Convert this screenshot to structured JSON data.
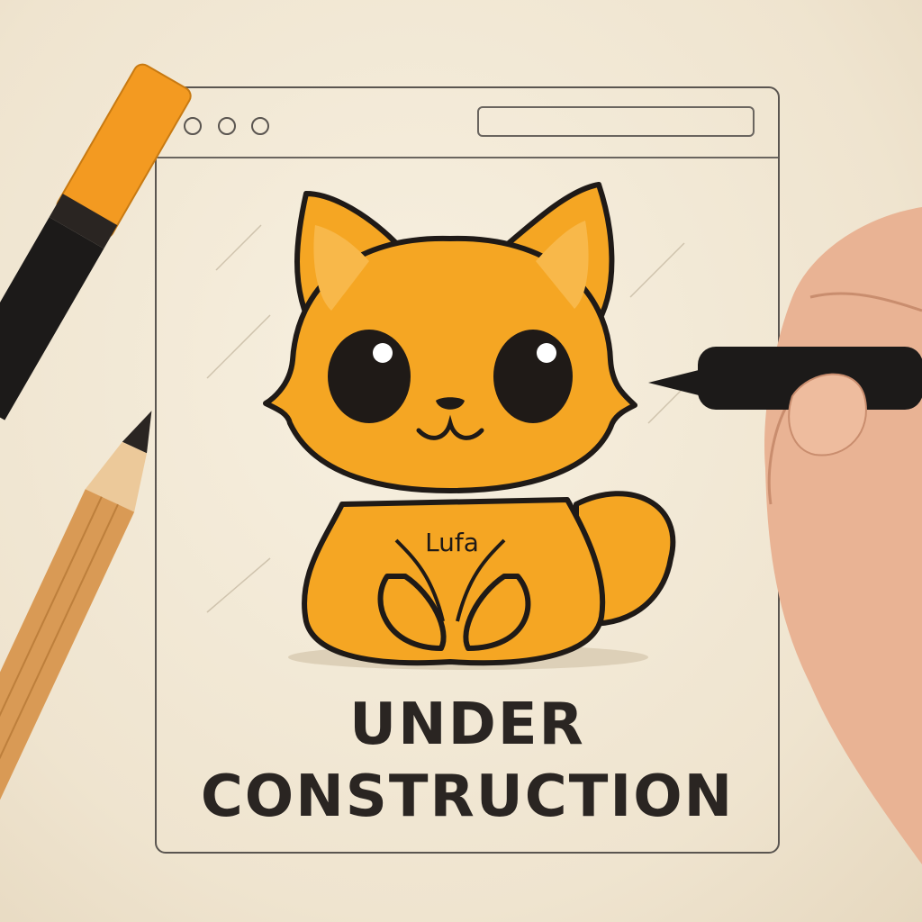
{
  "headline": {
    "line1": "UNDER",
    "line2": "CONSTRUCTION"
  },
  "mascot": {
    "chest_label": "Lufa",
    "color": "#f5a623"
  },
  "colors": {
    "paper": "#f3ead8",
    "ink": "#2a2522",
    "marker_orange": "#f39a21",
    "pencil_wood": "#d99a55"
  },
  "icons": [
    "orange-marker-icon",
    "pencil-icon",
    "black-pen-icon",
    "hand-icon",
    "browser-window-icon"
  ]
}
